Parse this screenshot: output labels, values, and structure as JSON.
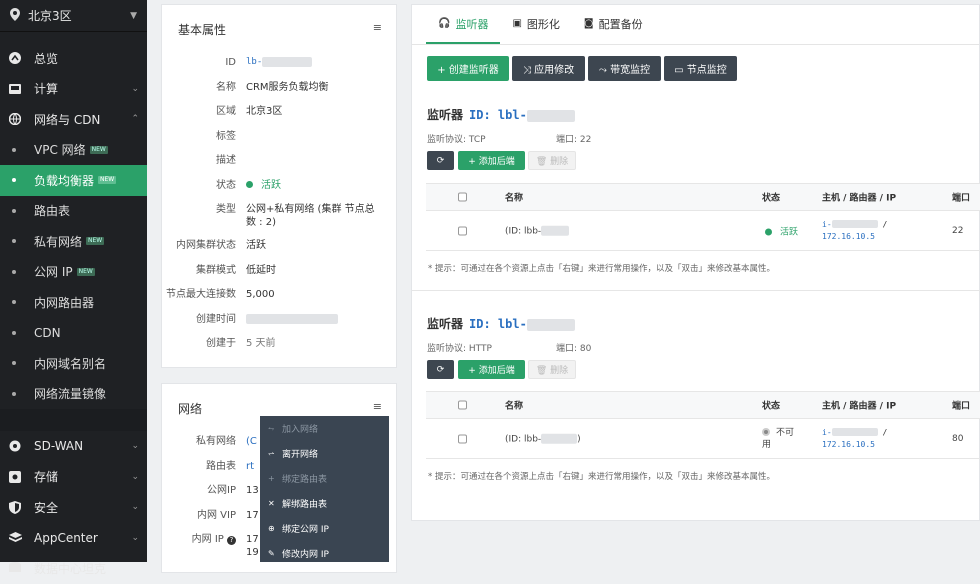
{
  "sidebar": {
    "zone": "北京3区",
    "items": [
      {
        "label": "总览"
      },
      {
        "label": "计算"
      },
      {
        "label": "网络与 CDN"
      }
    ],
    "sub": [
      {
        "label": "VPC 网络",
        "badge": "NEW"
      },
      {
        "label": "负载均衡器",
        "badge": "NEW"
      },
      {
        "label": "路由表"
      },
      {
        "label": "私有网络",
        "badge": "NEW"
      },
      {
        "label": "公网 IP",
        "badge": "NEW"
      },
      {
        "label": "内网路由器"
      },
      {
        "label": "CDN"
      },
      {
        "label": "内网域名别名"
      },
      {
        "label": "网络流量镜像"
      }
    ],
    "groups": [
      {
        "label": "SD-WAN"
      },
      {
        "label": "存储"
      },
      {
        "label": "安全"
      },
      {
        "label": "AppCenter"
      },
      {
        "label": "数据中心坦克"
      }
    ]
  },
  "basic": {
    "title": "基本属性",
    "menu": "≡",
    "labels": [
      "ID",
      "名称",
      "区域",
      "标签",
      "描述",
      "状态",
      "类型",
      "内网集群状态",
      "集群模式",
      "节点最大连接数",
      "创建时间",
      "创建于"
    ],
    "id_value": "lb-",
    "name_value": "CRM服务负载均衡",
    "zone_value": "北京3区",
    "status_value": "活跃",
    "type_value": "公网+私有网络 (集群 节点总数 : 2)",
    "cluster_status": "活跃",
    "cluster_mode": "低延时",
    "max_conn": "5,000",
    "created_ago": "5 天前"
  },
  "network": {
    "title": "网络",
    "menu": "≡",
    "labels": [
      "私有网络",
      "路由表",
      "公网IP",
      "内网 VIP",
      "内网 IP"
    ],
    "values": [
      "(C",
      "rt",
      "13",
      "17",
      "17"
    ],
    "extra_ip_lines": [
      "19"
    ],
    "help_icon": "?"
  },
  "context_menu": {
    "items": [
      {
        "label": "加入网络",
        "icon": "link-icon",
        "disabled": true
      },
      {
        "label": "离开网络",
        "icon": "unlink-icon",
        "disabled": false
      },
      {
        "label": "绑定路由表",
        "icon": "plus-icon",
        "disabled": true
      },
      {
        "label": "解绑路由表",
        "icon": "x-icon",
        "disabled": false
      },
      {
        "label": "绑定公网 IP",
        "icon": "globe-icon",
        "disabled": false
      },
      {
        "label": "修改内网 IP",
        "icon": "pencil-icon",
        "disabled": false
      }
    ]
  },
  "tabs": [
    {
      "label": "监听器",
      "icon": "headset-icon",
      "active": true
    },
    {
      "label": "图形化",
      "icon": "image-icon",
      "active": false
    },
    {
      "label": "配置备份",
      "icon": "camera-icon",
      "active": false
    }
  ],
  "toolbar": {
    "create": "+ 创建监听器",
    "apply": "⤨ 应用修改",
    "bandwidth": "⤳ 带宽监控",
    "node": "▭ 节点监控"
  },
  "listeners": [
    {
      "title": "监听器",
      "id_label": "ID: lbl-",
      "protocol_label": "监听协议: TCP",
      "port_label": "端口: 22",
      "add_backend": "+ 添加后端",
      "delete": "🗑 删除",
      "cols": [
        "名称",
        "状态",
        "主机 / 路由器 / IP",
        "端口"
      ],
      "row": {
        "name": "(ID: lbb-",
        "status": "活跃",
        "host_prefix": "i-",
        "host_sep": "/",
        "ip": "172.16.10.5",
        "port": "22"
      },
      "hint": "* 提示：可通过在各个资源上点击「右键」来进行常用操作，以及「双击」来修改基本属性。"
    },
    {
      "title": "监听器",
      "id_label": "ID: lbl-",
      "protocol_label": "监听协议: HTTP",
      "port_label": "端口: 80",
      "add_backend": "+ 添加后端",
      "delete": "🗑 删除",
      "cols": [
        "名称",
        "状态",
        "主机 / 路由器 / IP",
        "端口"
      ],
      "row": {
        "name": "(ID: lbb-",
        "name_close": ")",
        "status_line1": "不可",
        "status_line2": "用",
        "host_prefix": "i-",
        "host_sep": "/",
        "ip": "172.16.10.5",
        "port": "80"
      },
      "hint": "* 提示：可通过在各个资源上点击「右键」来进行常用操作，以及「双击」来修改基本属性。"
    }
  ],
  "colors": {
    "accent": "#2ba169",
    "sidebar_bg": "#1f2124",
    "menu_bg": "#3a4552",
    "id_blue": "#2a6fc0"
  }
}
